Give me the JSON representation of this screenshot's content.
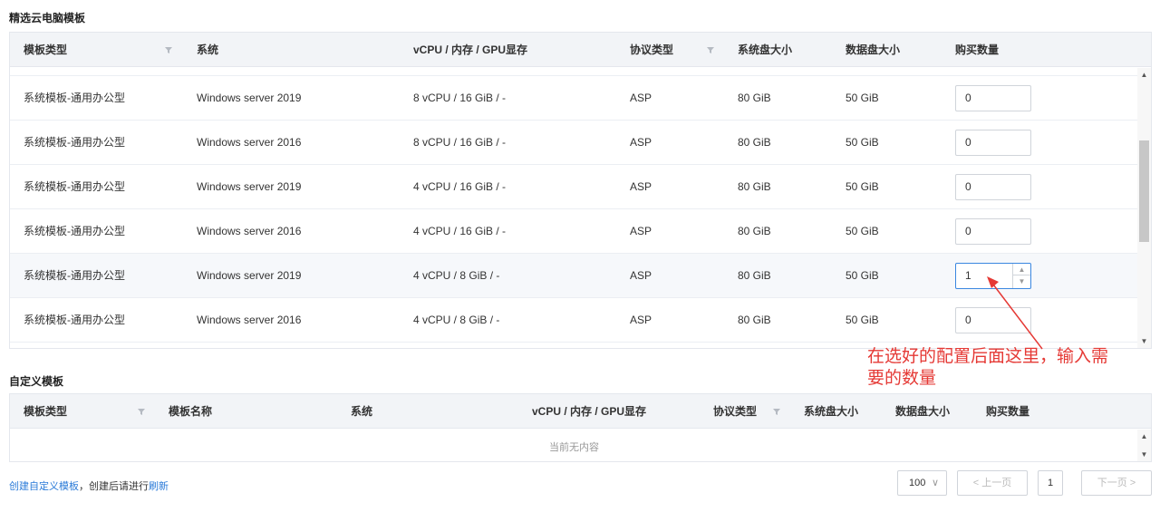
{
  "featured": {
    "title": "精选云电脑模板",
    "headers": {
      "type": "模板类型",
      "system": "系统",
      "spec": "vCPU / 内存 / GPU显存",
      "protocol": "协议类型",
      "sysdisk": "系统盘大小",
      "datadisk": "数据盘大小",
      "qty": "购买数量"
    },
    "rows": [
      {
        "type": "系统模板-通用办公型",
        "system": "Windows server 2019",
        "spec": "8 vCPU / 16 GiB / -",
        "protocol": "ASP",
        "sysdisk": "80 GiB",
        "datadisk": "50 GiB",
        "qty": "0"
      },
      {
        "type": "系统模板-通用办公型",
        "system": "Windows server 2016",
        "spec": "8 vCPU / 16 GiB / -",
        "protocol": "ASP",
        "sysdisk": "80 GiB",
        "datadisk": "50 GiB",
        "qty": "0"
      },
      {
        "type": "系统模板-通用办公型",
        "system": "Windows server 2019",
        "spec": "4 vCPU / 16 GiB / -",
        "protocol": "ASP",
        "sysdisk": "80 GiB",
        "datadisk": "50 GiB",
        "qty": "0"
      },
      {
        "type": "系统模板-通用办公型",
        "system": "Windows server 2016",
        "spec": "4 vCPU / 16 GiB / -",
        "protocol": "ASP",
        "sysdisk": "80 GiB",
        "datadisk": "50 GiB",
        "qty": "0"
      },
      {
        "type": "系统模板-通用办公型",
        "system": "Windows server 2019",
        "spec": "4 vCPU / 8 GiB / -",
        "protocol": "ASP",
        "sysdisk": "80 GiB",
        "datadisk": "50 GiB",
        "qty": "1"
      },
      {
        "type": "系统模板-通用办公型",
        "system": "Windows server 2016",
        "spec": "4 vCPU / 8 GiB / -",
        "protocol": "ASP",
        "sysdisk": "80 GiB",
        "datadisk": "50 GiB",
        "qty": "0"
      }
    ]
  },
  "custom": {
    "title": "自定义模板",
    "headers": {
      "type": "模板类型",
      "name": "模板名称",
      "system": "系统",
      "spec": "vCPU / 内存 / GPU显存",
      "protocol": "协议类型",
      "sysdisk": "系统盘大小",
      "datadisk": "数据盘大小",
      "qty": "购买数量"
    },
    "empty": "当前无内容"
  },
  "annotation": {
    "line1": "在选好的配置后面这里，输入需",
    "line2": "要的数量",
    "color": "#e53935"
  },
  "footer": {
    "create_link": "创建自定义模板",
    "middle_text": "，创建后请进行",
    "refresh_link": "刷新"
  },
  "pagination": {
    "page_size": "100",
    "prev": "< 上一页",
    "page": "1",
    "next": "下一页 >"
  },
  "colors": {
    "link": "#2b7bd8",
    "header_bg": "#f2f4f7",
    "active_border": "#3a87e0"
  }
}
